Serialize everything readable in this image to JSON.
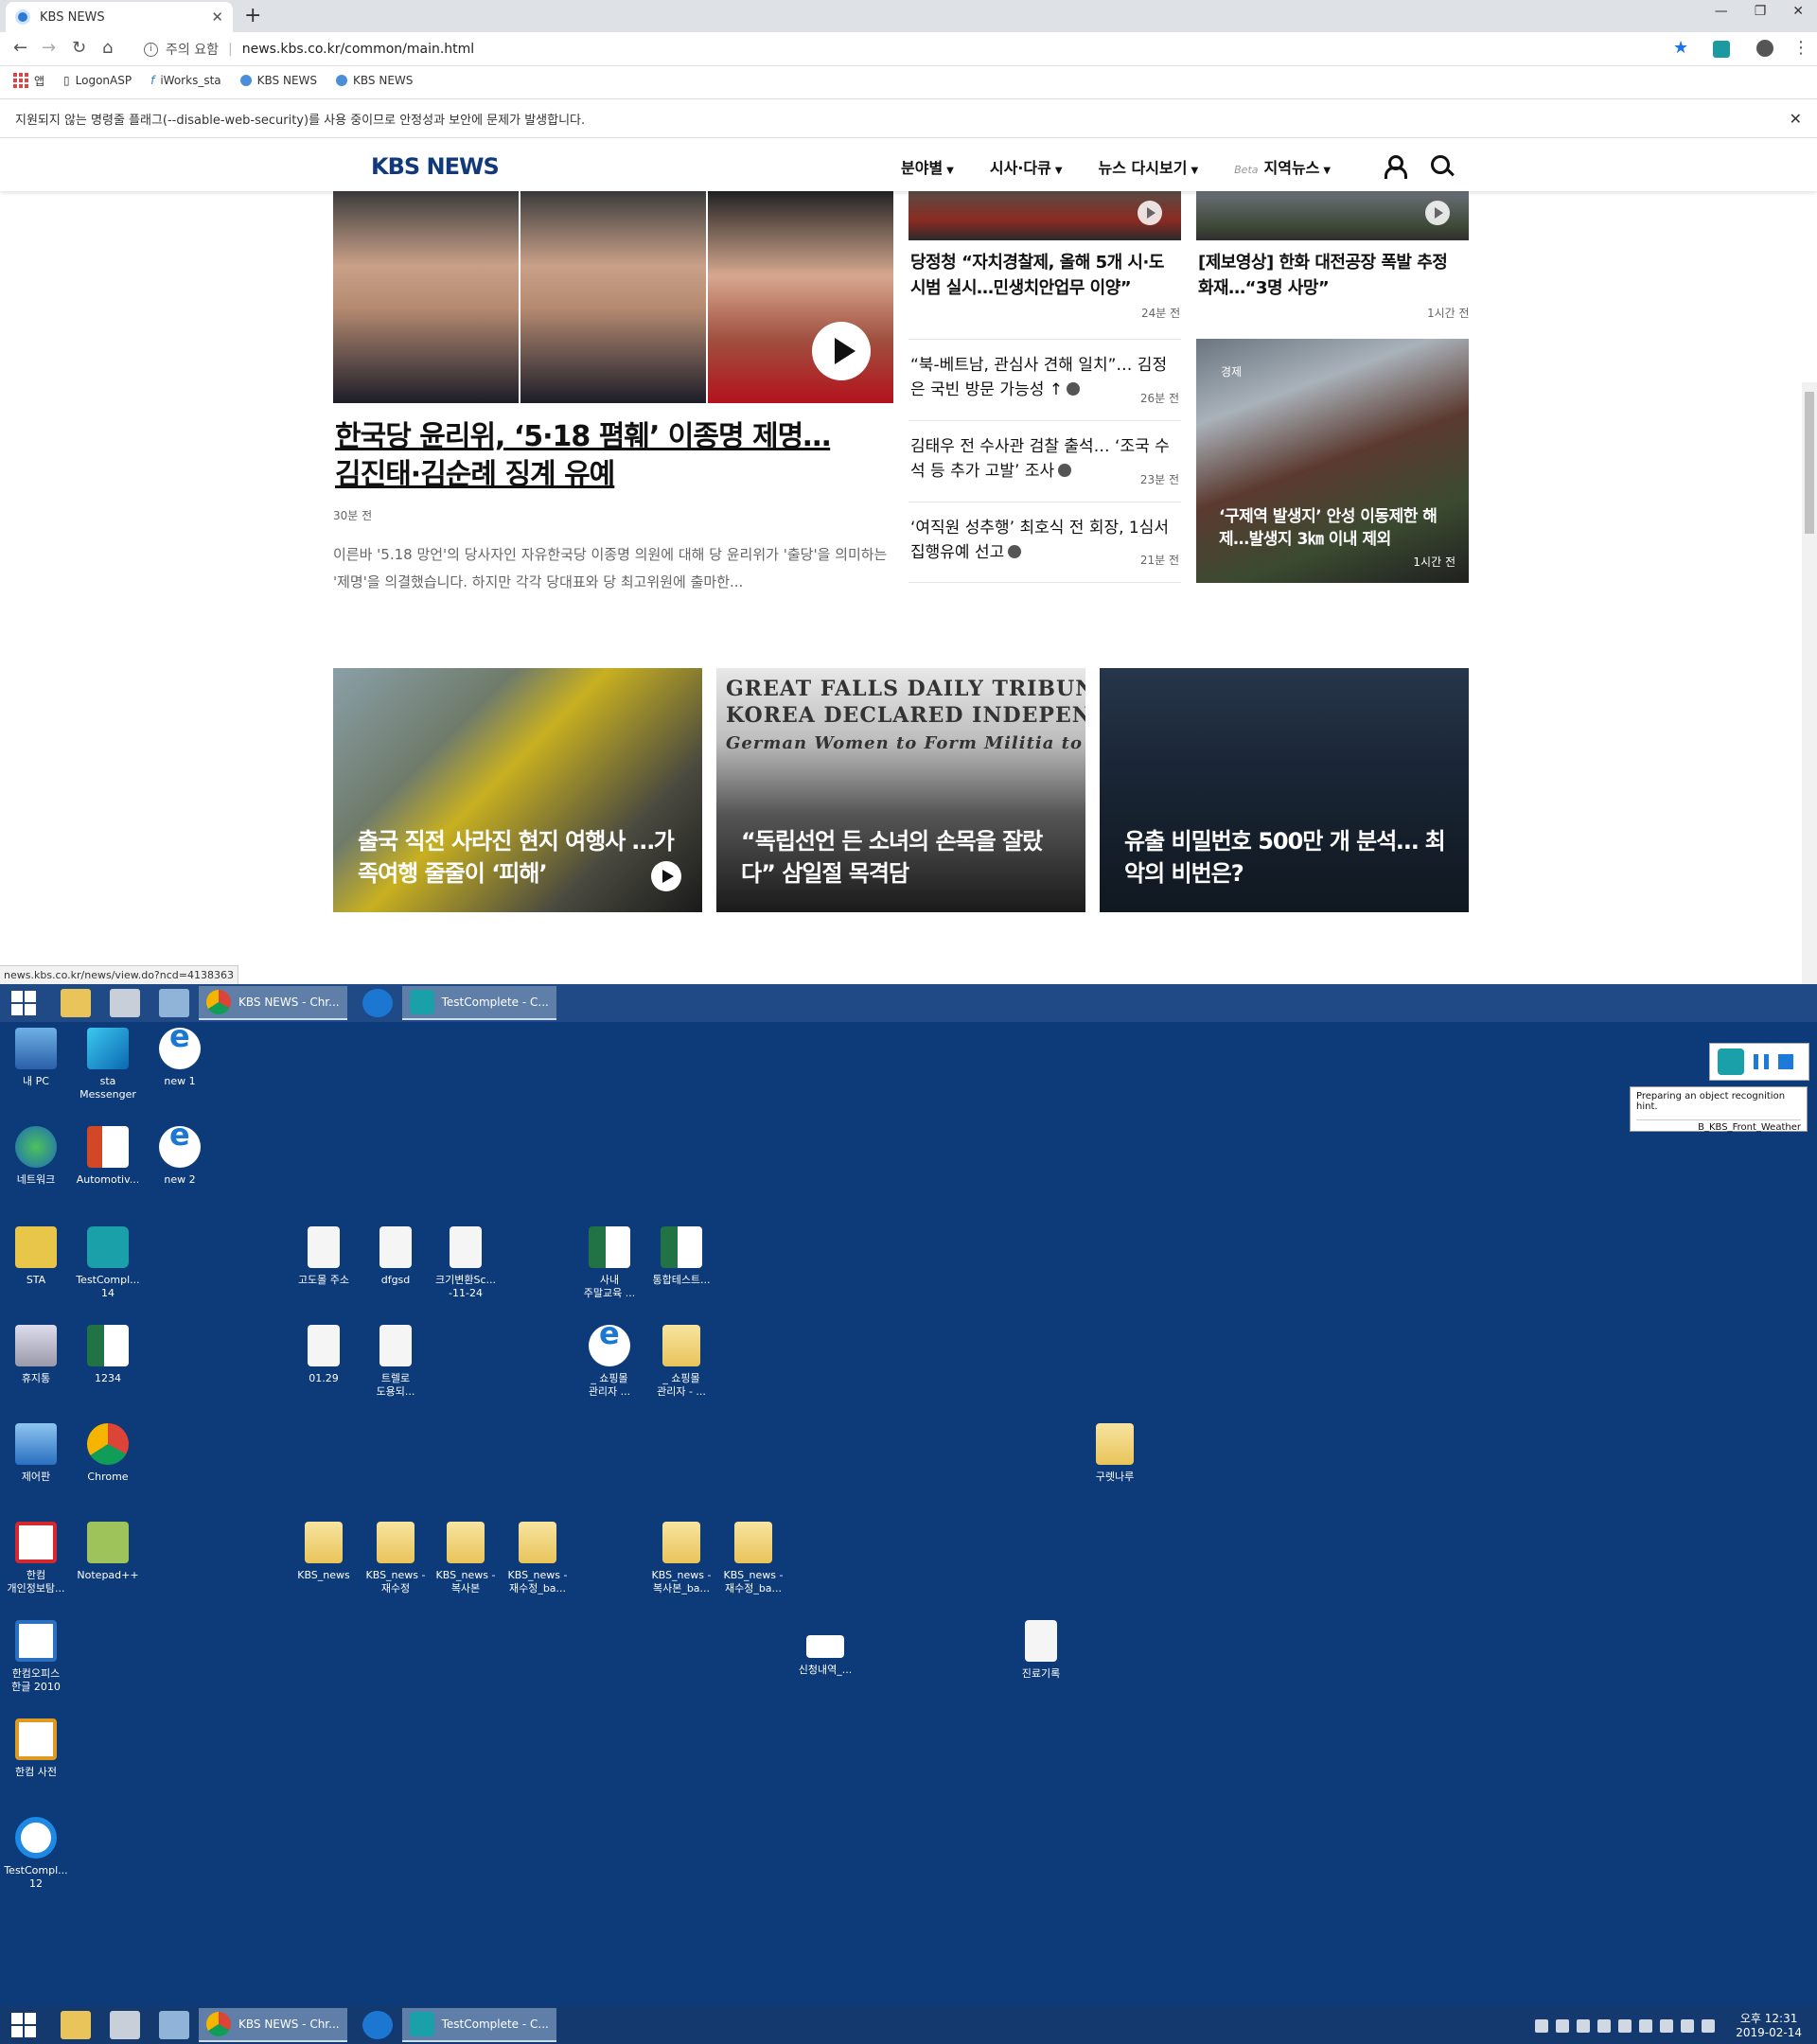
{
  "browser": {
    "tab_title": "KBS NEWS",
    "tab_close": "✕",
    "new_tab": "+",
    "window_controls": [
      "—",
      "❐",
      "✕"
    ],
    "security_label": "주의 요함",
    "url": "news.kbs.co.kr/common/main.html",
    "bookmarks": [
      "앱",
      "LogonASP",
      "iWorks_sta",
      "KBS NEWS",
      "KBS NEWS"
    ],
    "infobar_text": "지원되지 않는 명령줄 플래그(--disable-web-security)를 사용 중이므로 안정성과 보안에 문제가 발생합니다.",
    "infobar_close": "✕",
    "status_url": "news.kbs.co.kr/news/view.do?ncd=4138363"
  },
  "site": {
    "logo": "KBS NEWS",
    "nav": [
      {
        "label": "분야별"
      },
      {
        "label": "시사·다큐"
      },
      {
        "label": "뉴스 다시보기"
      },
      {
        "label": "지역뉴스",
        "prefix": "Beta"
      }
    ]
  },
  "main_story": {
    "headline": "한국당 윤리위, ‘5·18 폄훼’ 이종명 제명… 김진태·김순례 징계 유예",
    "time": "30분 전",
    "summary": "이른바 '5.18 망언'의 당사자인 자유한국당 이종명 의원에 대해 당 윤리위가 '출당'을 의미하는 '제명'을 의결했습니다. 하지만 각각 당대표와 당 최고위원에 출마한..."
  },
  "side_top": [
    {
      "headline": "당정청 “자치경찰제, 올해 5개 시·도 시범 실시…민생치안업무 이양”",
      "time": "24분 전"
    },
    {
      "headline": "[제보영상] 한화 대전공장 폭발 추정 화재…“3명 사망”",
      "time": "1시간 전"
    }
  ],
  "side_list": [
    {
      "text": "“북-베트남, 관심사 견해 일치”… 김정은 국빈 방문 가능성 ↑",
      "time": "26분 전"
    },
    {
      "text": "김태우 전 수사관 검찰 출석… ‘조국 수석 등 추가 고발’ 조사",
      "time": "23분 전"
    },
    {
      "text": "‘여직원 성추행’ 최호식 전 회장, 1심서 집행유예 선고",
      "time": "21분 전"
    }
  ],
  "side_photo": {
    "tag": "경제",
    "headline": "‘구제역 발생지’ 안성 이동제한 해제…발생지 3㎞ 이내 제외",
    "time": "1시간 전"
  },
  "cards": [
    {
      "headline": "출국 직전 사라진 현지 여행사 …가족여행 줄줄이 ‘피해’"
    },
    {
      "headline": "“독립선언 든 소녀의 손목을 잘랐다” 삼일절 목격담",
      "paper_text": "GREAT FALLS DAILY TRIBUN\nKOREA DECLARED INDEPENDE\nGerman Women to Form Militia to Fight"
    },
    {
      "headline": "유출 비밀번호 500만 개 분석… 최악의 비번은?"
    }
  ],
  "taskbar": {
    "tasks": [
      "KBS NEWS - Chr...",
      "TestComplete - C..."
    ],
    "clock_time": "오후 12:31",
    "clock_date": "2019-02-14"
  },
  "testcomplete": {
    "hint_line1": "Preparing an object recognition hint.",
    "hint_line2": "B_KBS_Front_Weather"
  },
  "desktop_icons": [
    {
      "label": "내 PC",
      "icon": "pc"
    },
    {
      "label": "sta\nMessenger",
      "icon": "cube"
    },
    {
      "label": "new 1",
      "icon": "ie"
    },
    {
      "label": "네트워크",
      "icon": "net"
    },
    {
      "label": "Automotiv...",
      "icon": "ppt"
    },
    {
      "label": "new 2",
      "icon": "ie"
    },
    {
      "label": "STA",
      "icon": "sta"
    },
    {
      "label": "TestCompl...\n14",
      "icon": "tc"
    },
    {
      "label": "고도몰 주소",
      "icon": "doc"
    },
    {
      "label": "dfgsd",
      "icon": "doc"
    },
    {
      "label": "크기변환Sc...\n-11-24",
      "icon": "doc"
    },
    {
      "label": "사내\n주말교육 ...",
      "icon": "xls"
    },
    {
      "label": "통합테스트...",
      "icon": "xls"
    },
    {
      "label": "휴지통",
      "icon": "bin"
    },
    {
      "label": "1234",
      "icon": "xls"
    },
    {
      "label": "01.29",
      "icon": "doc"
    },
    {
      "label": "트렐로\n도용되...",
      "icon": "doc"
    },
    {
      "label": "_ 쇼핑몰\n관리자 ...",
      "icon": "ie"
    },
    {
      "label": "_ 쇼핑몰\n관리자 - ...",
      "icon": "folder"
    },
    {
      "label": "제어판",
      "icon": "ctrl"
    },
    {
      "label": "Chrome",
      "icon": "chrome"
    },
    {
      "label": "구렛나루",
      "icon": "folder"
    },
    {
      "label": "한컴\n개인정보탐...",
      "icon": "hangul"
    },
    {
      "label": "Notepad++",
      "icon": "npp"
    },
    {
      "label": "KBS_news",
      "icon": "folder"
    },
    {
      "label": "KBS_news -\n재수정",
      "icon": "folder"
    },
    {
      "label": "KBS_news -\n복사본",
      "icon": "folder"
    },
    {
      "label": "KBS_news -\n재수정_ba...",
      "icon": "folder"
    },
    {
      "label": "KBS_news -\n복사본_ba...",
      "icon": "folder"
    },
    {
      "label": "KBS_news -\n재수정_ba...",
      "icon": "folder"
    },
    {
      "label": "한컴오피스\n한글 2010",
      "icon": "office"
    },
    {
      "label": "신청내역_...",
      "icon": "sheet"
    },
    {
      "label": "진료기록",
      "icon": "doc"
    },
    {
      "label": "한컴 사전",
      "icon": "dict"
    },
    {
      "label": "TestCompl...\n12",
      "icon": "tc12"
    }
  ]
}
